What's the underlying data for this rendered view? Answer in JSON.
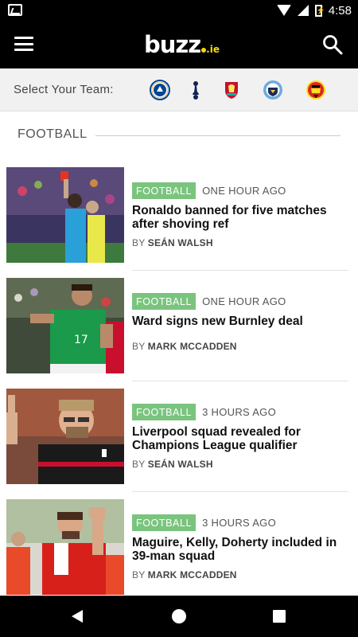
{
  "status": {
    "time": "4:58",
    "battery": "⚡"
  },
  "app": {
    "logo": "buzz",
    "logo_suffix": ".ie"
  },
  "team_bar": {
    "label": "Select Your Team:",
    "teams": [
      "chelsea-crest-icon",
      "tottenham-crest-icon",
      "liverpool-crest-icon",
      "man-city-crest-icon",
      "man-utd-crest-icon"
    ]
  },
  "section": {
    "title": "FOOTBALL"
  },
  "articles": [
    {
      "category": "FOOTBALL",
      "time": "ONE HOUR AGO",
      "headline": "Ronaldo banned for five matches after shoving ref",
      "by": "BY",
      "author": "SEÁN WALSH"
    },
    {
      "category": "FOOTBALL",
      "time": "ONE HOUR AGO",
      "headline": "Ward signs new Burnley deal",
      "by": "BY",
      "author": "MARK MCCADDEN"
    },
    {
      "category": "FOOTBALL",
      "time": "3 HOURS AGO",
      "headline": "Liverpool squad revealed for Champions League qualifier",
      "by": "BY",
      "author": "SEÁN WALSH"
    },
    {
      "category": "FOOTBALL",
      "time": "3 HOURS AGO",
      "headline": "Maguire, Kelly, Doherty included in 39-man squad",
      "by": "BY",
      "author": "MARK MCCADDEN"
    }
  ],
  "colors": {
    "badge": "#7ac47e",
    "logo_accent": "#f5d90a",
    "bar": "#000000"
  }
}
